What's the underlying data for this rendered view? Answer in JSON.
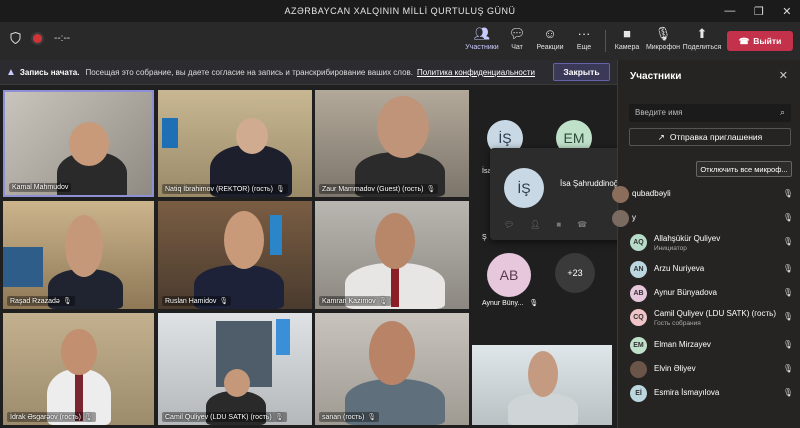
{
  "window": {
    "title": "AZƏRBAYCAN XALQININ MİLLİ QURTULUŞ GÜNÜ",
    "min": "—",
    "restore": "❐",
    "close": "✕"
  },
  "toolbar": {
    "timer": "--:--",
    "participants_label": "Участники",
    "chat_label": "Чат",
    "reactions_label": "Реакции",
    "more_label": "Еще",
    "camera_label": "Камера",
    "mic_label": "Микрофон",
    "share_label": "Поделиться",
    "leave_label": "Выйти"
  },
  "banner": {
    "bold": "Запись начата.",
    "text": "Посещая это собрание, вы даете согласие на запись и транскрибирование ваших слов.",
    "link": "Политика конфиденциальности",
    "button": "Закрыть"
  },
  "tiles": [
    {
      "name": "Kamal Mahmudov"
    },
    {
      "name": "Natiq İbrahimov (REKTOR) (гость)"
    },
    {
      "name": "Zaur Mammadov (Guest) (гость)"
    },
    {
      "name": "Raşad Rzazadə"
    },
    {
      "name": "Ruslan Hamidov"
    },
    {
      "name": "Kamran Kazımov"
    },
    {
      "name": "İdrak Əsgarəov (гость)"
    },
    {
      "name": "Camil Quliyev (LDU SATK) (гость)"
    },
    {
      "name": "sanan (гость)"
    }
  ],
  "mini": {
    "is_initials": "İŞ",
    "em_initials": "EM",
    "is_label": "İsa",
    "s_label": "Ş",
    "ab_initials": "AB",
    "ab_name": "Aynur Büny...",
    "more_count": "+23"
  },
  "popup": {
    "initials": "İŞ",
    "name": "İsa Şahruddinoğlu (гость)"
  },
  "panel": {
    "title": "Участники",
    "search_placeholder": "Введите имя",
    "invite_label": "Отправка приглашения",
    "mute_all": "Отключить все микроф...",
    "people": [
      {
        "initials": "",
        "name": "qubadbəyli",
        "sub": "",
        "color": "#8a6d5a"
      },
      {
        "initials": "",
        "name": "y",
        "sub": "",
        "color": "#7b6a60"
      },
      {
        "initials": "AQ",
        "name": "Allahşükür Quliyev",
        "sub": "Инициатор",
        "color": "#b7dbc9"
      },
      {
        "initials": "AN",
        "name": "Arzu Nuriyeva",
        "sub": "",
        "color": "#bcd6df"
      },
      {
        "initials": "AB",
        "name": "Aynur Bünyadova",
        "sub": "",
        "color": "#e6c7dc"
      },
      {
        "initials": "CQ",
        "name": "Camil Quliyev (LDU SATK) (гость)",
        "sub": "Гость собрания",
        "color": "#efc3c7"
      },
      {
        "initials": "EM",
        "name": "Elman Mirzayev",
        "sub": "",
        "color": "#bfe0c9"
      },
      {
        "initials": "",
        "name": "Elvin Əliyev",
        "sub": "",
        "color": "#6b5548"
      },
      {
        "initials": "Eİ",
        "name": "Esmira İsmayılova",
        "sub": "",
        "color": "#bcd6df"
      }
    ]
  }
}
